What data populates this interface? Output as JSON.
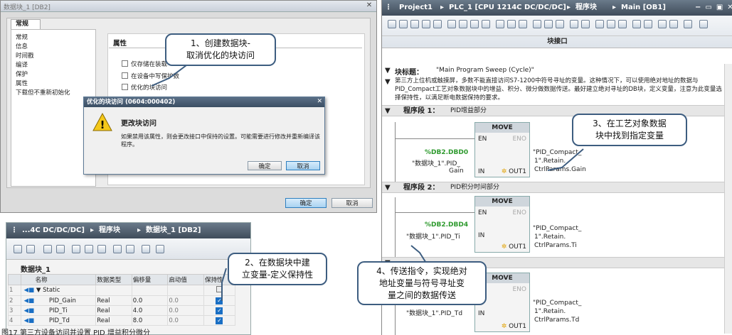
{
  "dialog_window": {
    "title": "数据块_1 [DB2]",
    "tab": "常规",
    "nav": [
      "常规",
      "信息",
      "时间戳",
      "编译",
      "保护",
      "属性",
      "下载但不重新初始化"
    ],
    "section_title": "属性",
    "options": [
      "仅存储在装载",
      "在设备中写保护数",
      "优化的块访问"
    ],
    "ok_label": "确定",
    "cancel_label": "取消"
  },
  "confirm_dialog": {
    "title": "优化的块访问 (0604:000402)",
    "heading": "更改块访问",
    "message": "如果禁用该属性，则会更改接口中保持的设置。可能需要进行修改并重新编译该程序。",
    "ok_label": "确定",
    "cancel_label": "取消"
  },
  "db_editor": {
    "breadcrumb": [
      "...4C DC/DC/DC]",
      "程序块",
      "数据块_1 [DB2]"
    ],
    "block_name": "数据块_1",
    "columns": [
      "名称",
      "数据类型",
      "偏移量",
      "启动值",
      "保持性"
    ],
    "rows": [
      {
        "num": "1",
        "name": "▼ Static",
        "type": "",
        "offset": "",
        "start": "",
        "retain": false
      },
      {
        "num": "2",
        "name": "PID_Gain",
        "type": "Real",
        "offset": "0.0",
        "start": "0.0",
        "retain": true
      },
      {
        "num": "3",
        "name": "PID_Ti",
        "type": "Real",
        "offset": "4.0",
        "start": "0.0",
        "retain": true
      },
      {
        "num": "4",
        "name": "PID_Td",
        "type": "Real",
        "offset": "8.0",
        "start": "0.0",
        "retain": true
      }
    ]
  },
  "program_editor": {
    "breadcrumb": [
      "Project1",
      "PLC_1 [CPU 1214C DC/DC/DC]",
      "程序块",
      "Main [OB1]"
    ],
    "interface_label": "块接口",
    "block_title_label": "块标题：",
    "block_title": "\"Main Program Sweep (Cycle)\"",
    "comment": "第三方上位机或触摸屏，多数不能直接访问S7-1200中符号寻址的变量。这种情况下，可以使用绝对地址的数据与PID_Compact工艺对象数据块中的增益、积分、微分做数据传送。最好建立绝对寻址的DB块，定义变量，注意为此变量选择保持性，以满足断电数据保持的要求。",
    "networks": [
      {
        "label": "程序段 1：",
        "title": "PID增益部分",
        "instr": "MOVE",
        "in_addr": "%DB2.DBD0",
        "in_sym1": "\"数据块_1\".PID_",
        "in_sym2": "Gain",
        "out1": "\"PID_Compact_",
        "out2": "1\".Retain.",
        "out3": "CtrlParams.Gain"
      },
      {
        "label": "程序段 2：",
        "title": "PID积分时间部分",
        "instr": "MOVE",
        "in_addr": "%DB2.DBD4",
        "in_sym1": "\"数据块_1\".PID_Ti",
        "in_sym2": "",
        "out1": "\"PID_Compact_",
        "out2": "1\".Retain.",
        "out3": "CtrlParams.Ti"
      },
      {
        "label": "",
        "title": "",
        "instr": "MOVE",
        "in_addr": "",
        "in_sym1": "\"数据块_1\".PID_Td",
        "in_sym2": "",
        "out1": "\"PID_Compact_",
        "out2": "1\".Retain.",
        "out3": "CtrlParams.Td"
      }
    ],
    "pins": {
      "en": "EN",
      "eno": "ENO",
      "in": "IN",
      "out1": "OUT1"
    }
  },
  "callouts": {
    "c1_l1": "1、创建数据块-",
    "c1_l2": "取消优化的块访问",
    "c2_l1": "2、在数据块中建",
    "c2_l2": "立变量-定义保持性",
    "c3_l1": "3、在工艺对象数据",
    "c3_l2": "块中找到指定变量",
    "c4_l1": "4、传送指令，实现绝对",
    "c4_l2": "地址变量与符号寻址变",
    "c4_l3": "量之间的数据传送"
  },
  "caption": "图17 第三方设备访问并设置 PID 增益积分微分"
}
